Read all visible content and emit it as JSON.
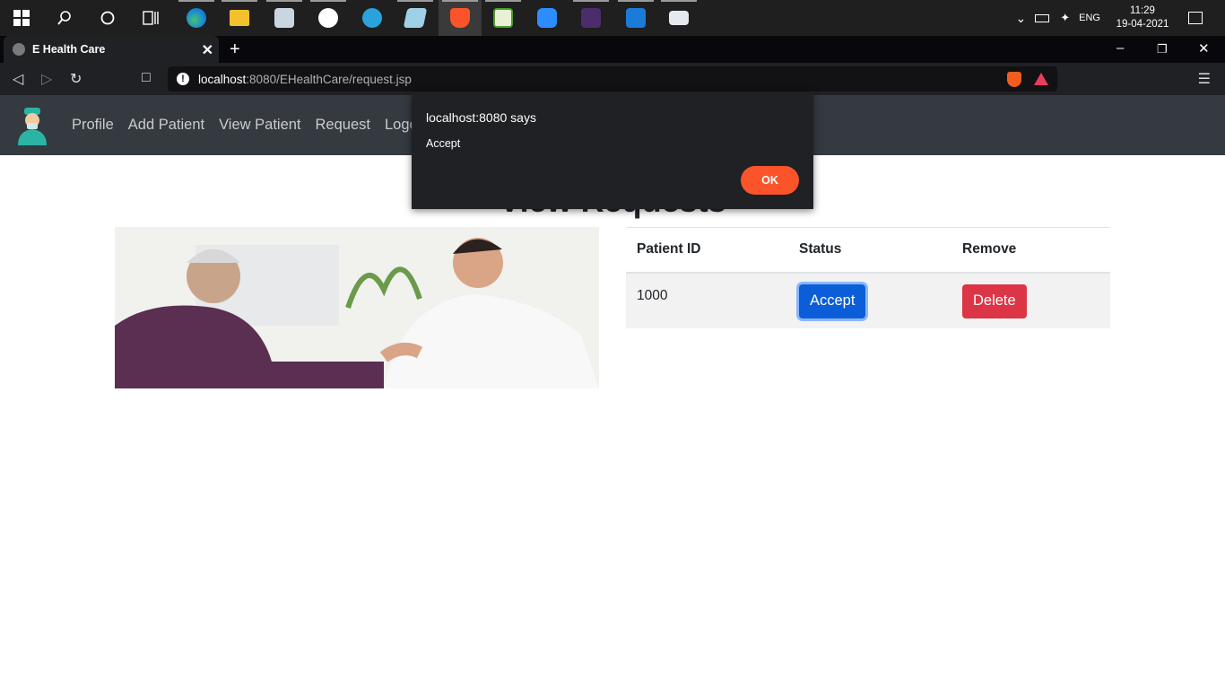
{
  "taskbar": {
    "clock_time": "11:29",
    "clock_date": "19-04-2021",
    "language": "ENG",
    "apps": [
      "windows-start",
      "search",
      "cortana",
      "task-view",
      "edge",
      "file-explorer",
      "task-manager",
      "app-n",
      "telegram",
      "notepad-app",
      "brave",
      "app-green",
      "zoom",
      "app-dark",
      "photos",
      "app-window"
    ]
  },
  "browser": {
    "tab_title": "E Health Care",
    "url_host": "localhost",
    "url_rest": ":8080/EHealthCare/request.jsp"
  },
  "navbar": {
    "links": [
      "Profile",
      "Add Patient",
      "View Patient",
      "Request",
      "Logout"
    ]
  },
  "page": {
    "heading": "View Requests",
    "table": {
      "headers": [
        "Patient ID",
        "Status",
        "Remove"
      ],
      "rows": [
        {
          "patient_id": "1000",
          "status_button": "Accept",
          "remove_button": "Delete"
        }
      ]
    }
  },
  "dialog": {
    "origin": "localhost:8080 says",
    "message": "Accept",
    "ok_label": "OK"
  },
  "colors": {
    "navbar_bg": "#343a40",
    "accept_button": "#0b5ed7",
    "delete_button": "#dc3545",
    "dialog_ok": "#fb542b"
  }
}
